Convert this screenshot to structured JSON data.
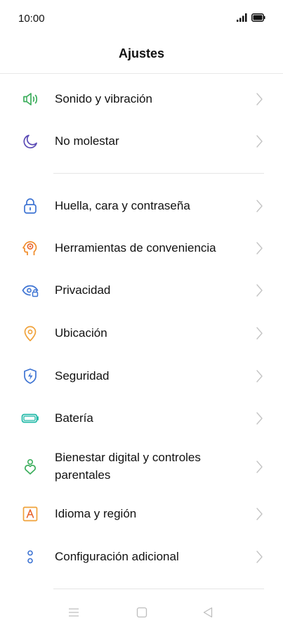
{
  "status_bar": {
    "time": "10:00",
    "signal_icon": "signal-icon",
    "battery_icon": "battery-icon"
  },
  "header": {
    "title": "Ajustes"
  },
  "settings": {
    "items": [
      {
        "label": "Sonido y vibración",
        "icon": "speaker-icon",
        "color": "#3cae5c"
      },
      {
        "label": "No molestar",
        "icon": "moon-icon",
        "color": "#5b4bb5"
      },
      {
        "label": "Huella, cara y contraseña",
        "icon": "lock-icon",
        "color": "#3e74d3"
      },
      {
        "label": "Herramientas de conveniencia",
        "icon": "convenience-tools-icon",
        "color": "#f08c2a"
      },
      {
        "label": "Privacidad",
        "icon": "privacy-eye-icon",
        "color": "#3e74d3"
      },
      {
        "label": "Ubicación",
        "icon": "location-pin-icon",
        "color": "#f0a23a"
      },
      {
        "label": "Seguridad",
        "icon": "security-shield-icon",
        "color": "#3e74d3"
      },
      {
        "label": "Batería",
        "icon": "battery-settings-icon",
        "color": "#1fb8a6"
      },
      {
        "label_line1": "Bienestar digital y controles",
        "label_line2": "parentales",
        "icon": "wellbeing-heart-icon",
        "color": "#3cae5c"
      },
      {
        "label": "Idioma y región",
        "icon": "language-icon",
        "color": "#f0a23a"
      },
      {
        "label": "Configuración adicional",
        "icon": "additional-settings-icon",
        "color": "#3e74d3"
      }
    ]
  },
  "navigation": {
    "menu_icon": "menu-icon",
    "home_icon": "home-icon",
    "back_icon": "back-icon"
  }
}
